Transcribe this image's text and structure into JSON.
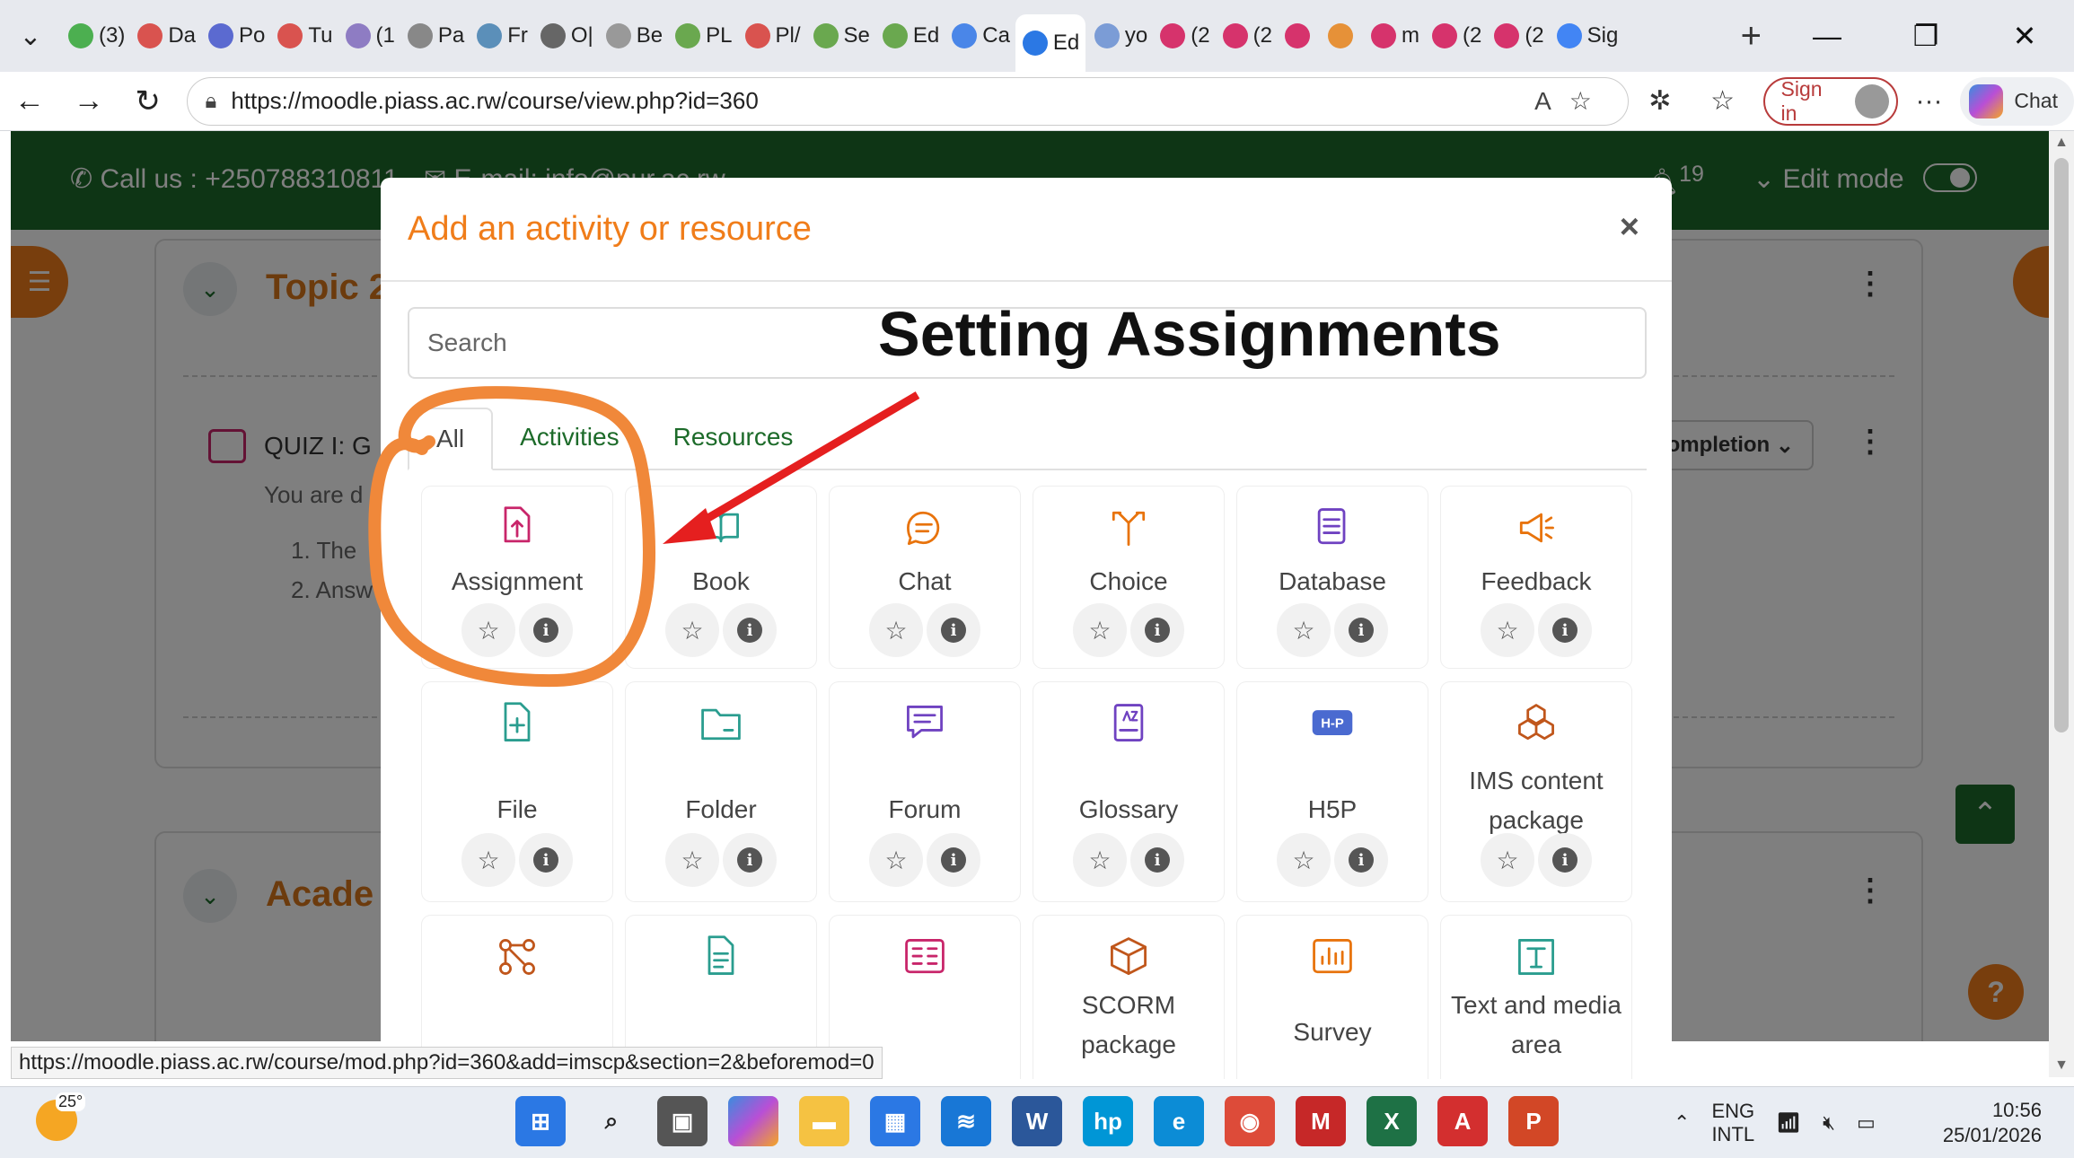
{
  "browser": {
    "tabs": [
      {
        "label": "(3)",
        "color": "#4caf50"
      },
      {
        "label": "Da",
        "color": "#d9534f"
      },
      {
        "label": "Po",
        "color": "#5b6ad0"
      },
      {
        "label": "Tu",
        "color": "#d9534f"
      },
      {
        "label": "(1",
        "color": "#8e7cc3"
      },
      {
        "label": "Pa",
        "color": "#888888"
      },
      {
        "label": "Fr",
        "color": "#5b8fb9"
      },
      {
        "label": "O|",
        "color": "#666666"
      },
      {
        "label": "Be",
        "color": "#999999"
      },
      {
        "label": "PL",
        "color": "#6aa84f"
      },
      {
        "label": "Pl/",
        "color": "#d9534f"
      },
      {
        "label": "Se",
        "color": "#6aa84f"
      },
      {
        "label": "Ed",
        "color": "#6aa84f"
      },
      {
        "label": "Ca",
        "color": "#4a86e8"
      }
    ],
    "active_tab": {
      "label": "Ed",
      "close": "×"
    },
    "tabs_after": [
      {
        "label": "yo",
        "color": "#7b9cd6"
      },
      {
        "label": "(2",
        "color": "#d6336c"
      },
      {
        "label": "(2",
        "color": "#d6336c"
      },
      {
        "label": "",
        "color": "#d6336c"
      },
      {
        "label": "",
        "color": "#e69138"
      },
      {
        "label": "m",
        "color": "#d6336c"
      },
      {
        "label": "(2",
        "color": "#d6336c"
      },
      {
        "label": "(2",
        "color": "#d6336c"
      },
      {
        "label": "Sig",
        "color": "#4285f4"
      }
    ],
    "new_tab": "+",
    "window_controls": {
      "minimize": "—",
      "restore": "❐",
      "close": "✕"
    },
    "url": "https://moodle.piass.ac.rw/course/view.php?id=360",
    "sign_in": "Sign in",
    "chat": "Chat"
  },
  "moodle": {
    "call": "Call us : +250788310811",
    "email": "E-mail: info@pur.ac.rw",
    "notifications_badge": "19",
    "edit_mode": "Edit mode",
    "section1_title": "Topic 2",
    "quiz_title": "QUIZ I: G",
    "completion": "ompletion",
    "desc_line": "You are d",
    "list_item_1": "1. The",
    "list_item_2": "2. Answ",
    "section2_title": "Acade"
  },
  "modal": {
    "title": "Add an activity or resource",
    "close": "×",
    "search_placeholder": "Search",
    "tabs": [
      "All",
      "Activities",
      "Resources"
    ],
    "items": [
      {
        "label": "Assignment",
        "icon": "assignment-icon",
        "color": "#c8256a"
      },
      {
        "label": "Book",
        "icon": "book-icon",
        "color": "#2a9d8f"
      },
      {
        "label": "Chat",
        "icon": "chat-icon",
        "color": "#e8730c"
      },
      {
        "label": "Choice",
        "icon": "choice-icon",
        "color": "#e8730c"
      },
      {
        "label": "Database",
        "icon": "database-icon",
        "color": "#6f42c1"
      },
      {
        "label": "Feedback",
        "icon": "feedback-icon",
        "color": "#e8730c"
      },
      {
        "label": "File",
        "icon": "file-icon",
        "color": "#2a9d8f"
      },
      {
        "label": "Folder",
        "icon": "folder-icon",
        "color": "#2a9d8f"
      },
      {
        "label": "Forum",
        "icon": "forum-icon",
        "color": "#6f42c1"
      },
      {
        "label": "Glossary",
        "icon": "glossary-icon",
        "color": "#6f42c1"
      },
      {
        "label": "H5P",
        "icon": "h5p-icon",
        "color": "#4a6ad0"
      },
      {
        "label": "IMS content package",
        "icon": "ims-package-icon",
        "color": "#c0561b"
      },
      {
        "label": "",
        "icon": "lesson-icon",
        "color": "#c0561b"
      },
      {
        "label": "",
        "icon": "page-icon",
        "color": "#2a9d8f"
      },
      {
        "label": "",
        "icon": "quiz-icon",
        "color": "#c8256a"
      },
      {
        "label": "SCORM package",
        "icon": "scorm-icon",
        "color": "#c0561b"
      },
      {
        "label": "Survey",
        "icon": "survey-icon",
        "color": "#e8730c"
      },
      {
        "label": "Text and media area",
        "icon": "text-media-icon",
        "color": "#2a9d8f"
      }
    ]
  },
  "annotation": {
    "text": "Setting Assignments",
    "circle_color": "#f0883a",
    "arrow_color": "#e51f1f"
  },
  "status_url": "https://moodle.piass.ac.rw/course/mod.php?id=360&add=imscp&section=2&beforemod=0",
  "taskbar": {
    "weather_temp": "25°",
    "lang_line1": "ENG",
    "lang_line2": "INTL",
    "time": "10:56",
    "date": "25/01/2026"
  }
}
